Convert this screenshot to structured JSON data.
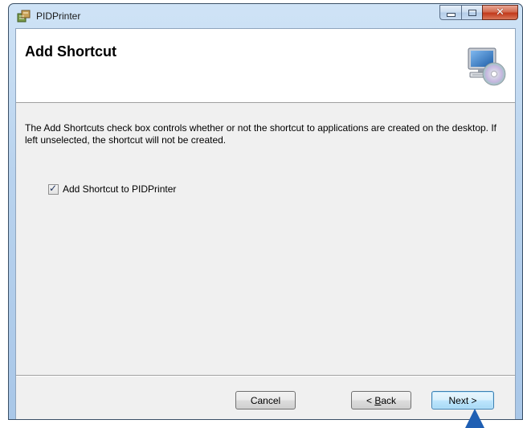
{
  "window": {
    "title": "PIDPrinter",
    "controls": {
      "minimize_icon": "minimize-icon",
      "maximize_icon": "maximize-icon",
      "close_icon": "close-icon"
    }
  },
  "banner": {
    "title": "Add Shortcut",
    "icon": "computer-cd-icon"
  },
  "body": {
    "description": "The Add Shortcuts check box controls whether or not the shortcut to applications are created on the desktop. If left unselected, the shortcut will not be created.",
    "checkbox": {
      "label": "Add Shortcut to PIDPrinter",
      "checked": true
    }
  },
  "buttons": {
    "cancel": "Cancel",
    "back_prefix": "< ",
    "back_accel": "B",
    "back_rest": "ack",
    "next": "Next >"
  },
  "colors": {
    "accent": "#3c7fb1",
    "close_button": "#c2391b",
    "pointer": "#1f5fb3"
  }
}
